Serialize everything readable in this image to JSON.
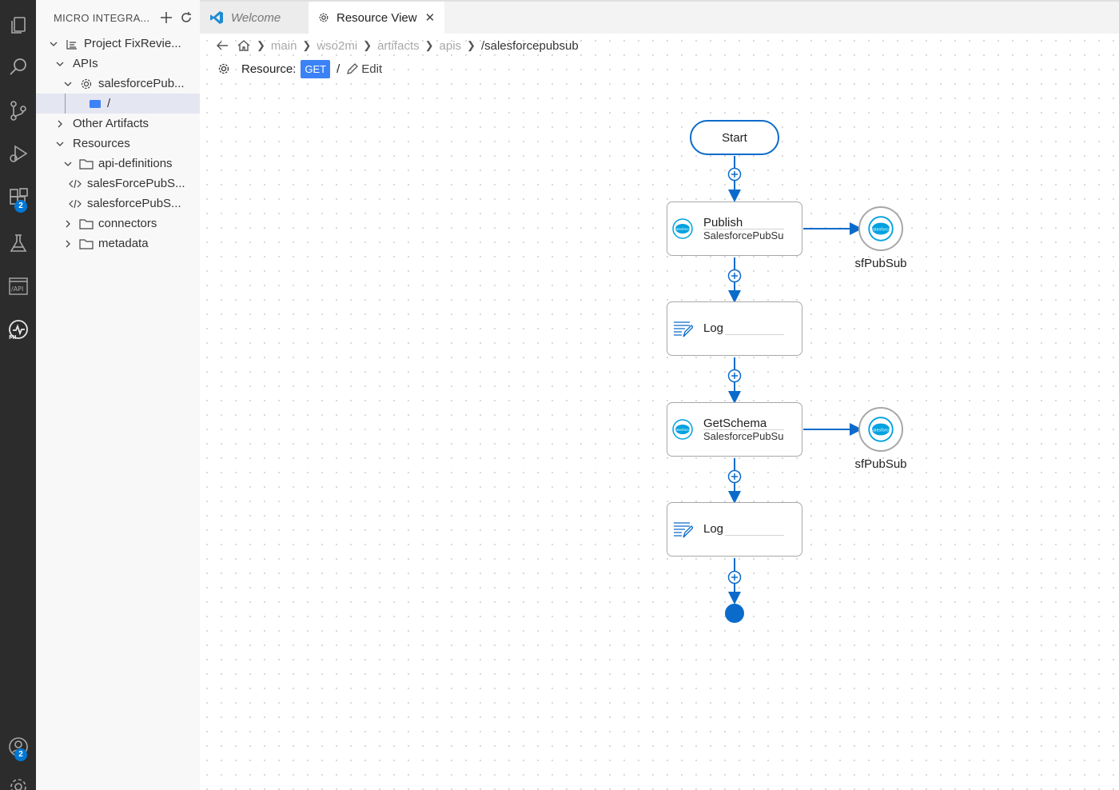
{
  "activity_bar": {
    "icons": [
      "explorer-icon",
      "search-icon",
      "source-control-icon",
      "run-debug-icon",
      "extensions-icon",
      "testing-icon",
      "api-icon",
      "micro-integrator-icon",
      "accounts-icon",
      "settings-icon"
    ],
    "extensions_badge": "2",
    "accounts_badge": "2",
    "api_icon_text": "/API",
    "mi_icon_text": "MI"
  },
  "sidebar": {
    "title": "MICRO INTEGRA...",
    "tree": {
      "project": "Project FixRevie...",
      "apis": "APIs",
      "api": "salesforcePub...",
      "resource": "/",
      "other_artifacts": "Other Artifacts",
      "resources": "Resources",
      "api_definitions": "api-definitions",
      "file1": "salesForcePubS...",
      "file2": "salesforcePubS...",
      "connectors": "connectors",
      "metadata": "metadata"
    }
  },
  "tabs": {
    "welcome": "Welcome",
    "resource_view": "Resource View"
  },
  "breadcrumb": {
    "items": [
      "main",
      "wso2mi",
      "artifacts",
      "apis"
    ],
    "current": "/salesforcepubsub"
  },
  "resource": {
    "label": "Resource:",
    "method": "GET",
    "path": "/",
    "edit": "Edit"
  },
  "diagram": {
    "start": "Start",
    "nodes": [
      {
        "title": "Publish",
        "subtitle": "SalesforcePubSu"
      },
      {
        "title": "Log"
      },
      {
        "title": "GetSchema",
        "subtitle": "SalesforcePubSu"
      },
      {
        "title": "Log"
      }
    ],
    "connections": [
      "sfPubSub",
      "sfPubSub"
    ],
    "salesforce_logo_text": "salesforce"
  },
  "colors": {
    "accent": "#0b6bcb",
    "get_badge": "#3b82f6",
    "activity_bar": "#2c2c2c",
    "sidebar": "#f8f8f8"
  }
}
